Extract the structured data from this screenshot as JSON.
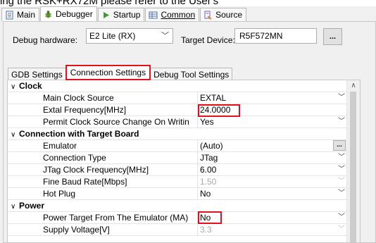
{
  "caption": "ing the RSK+RX72M please refer to the User's",
  "tabs": [
    {
      "label": "Main"
    },
    {
      "label": "Debugger"
    },
    {
      "label": "Startup"
    },
    {
      "label": "Common"
    },
    {
      "label": "Source"
    }
  ],
  "debug_hardware": {
    "label": "Debug hardware:",
    "value": "E2 Lite (RX)"
  },
  "target_device": {
    "label": "Target Device:",
    "value": "R5F572MN",
    "browse": "..."
  },
  "sub_tabs": [
    "GDB Settings",
    "Connection Settings",
    "Debug Tool Settings"
  ],
  "grid": {
    "clock": {
      "title": "Clock",
      "main_clock_source": {
        "name": "Main Clock Source",
        "value": "EXTAL"
      },
      "extal_freq": {
        "name": "Extal Frequency[MHz]",
        "value": "24.0000"
      },
      "permit_change": {
        "name": "Permit Clock Source Change On Writin",
        "value": "Yes"
      }
    },
    "connection": {
      "title": "Connection with Target Board",
      "emulator": {
        "name": "Emulator",
        "value": "(Auto)",
        "browse": "..."
      },
      "conn_type": {
        "name": "Connection Type",
        "value": "JTag"
      },
      "jtag_freq": {
        "name": "JTag Clock Frequency[MHz]",
        "value": "6.00"
      },
      "fine_baud": {
        "name": "Fine Baud Rate[Mbps]",
        "value": "1.50"
      },
      "hot_plug": {
        "name": "Hot Plug",
        "value": "No"
      }
    },
    "power": {
      "title": "Power",
      "power_target": {
        "name": "Power Target From The Emulator (MA)",
        "value": "No"
      },
      "supply_voltage": {
        "name": "Supply Voltage[V]",
        "value": "3.3"
      }
    }
  },
  "highlight_color": "#e0101c"
}
